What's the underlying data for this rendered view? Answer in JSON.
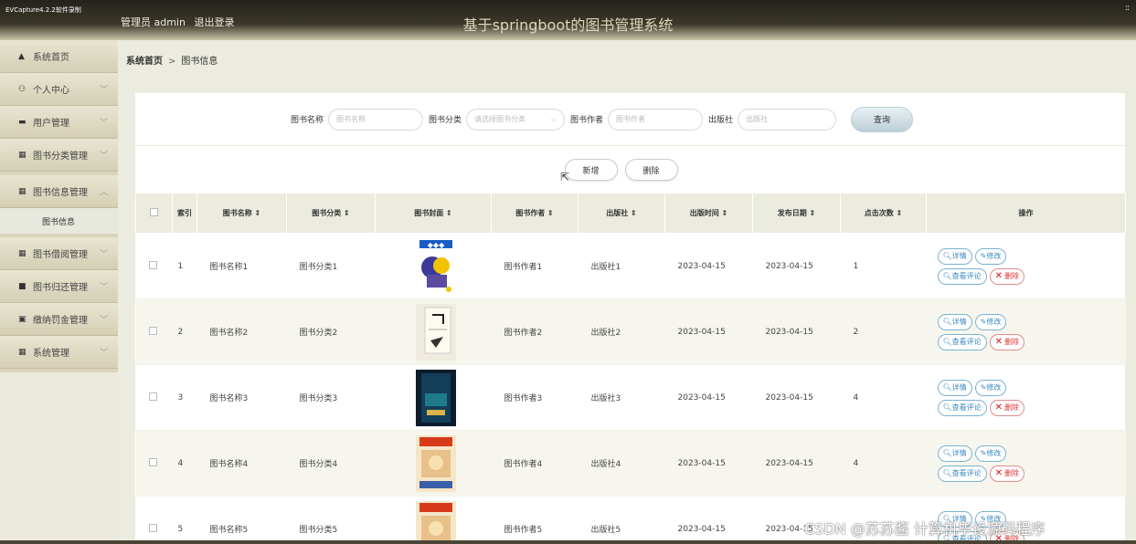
{
  "window": {
    "recorder": "EVCapture4.2.2软件录制",
    "grip": "::"
  },
  "header": {
    "user_label": "管理员 admin",
    "logout": "退出登录",
    "title": "基于springboot的图书管理系统"
  },
  "sidebar": {
    "items": [
      {
        "label": "系统首页",
        "icon": "home-icon",
        "glyph": "▲"
      },
      {
        "label": "个人中心",
        "icon": "user-icon",
        "glyph": "⚇"
      },
      {
        "label": "用户管理",
        "icon": "users-icon",
        "glyph": "▬"
      },
      {
        "label": "图书分类管理",
        "icon": "grid-icon",
        "glyph": "▦"
      },
      {
        "label": "图书信息管理",
        "icon": "grid-icon",
        "glyph": "▦"
      },
      {
        "label": "图书借阅管理",
        "icon": "grid-icon",
        "glyph": "▦"
      },
      {
        "label": "图书归还管理",
        "icon": "doc-icon",
        "glyph": "■"
      },
      {
        "label": "缴纳罚金管理",
        "icon": "money-icon",
        "glyph": "▣"
      },
      {
        "label": "系统管理",
        "icon": "table-icon",
        "glyph": "▦"
      }
    ],
    "subitem": "图书信息"
  },
  "breadcrumb": {
    "home": "系统首页",
    "sep": ">",
    "current": "图书信息"
  },
  "search": {
    "name_label": "图书名称",
    "name_placeholder": "图书名称",
    "cat_label": "图书分类",
    "cat_placeholder": "请选择图书分类",
    "author_label": "图书作者",
    "author_placeholder": "图书作者",
    "pub_label": "出版社",
    "pub_placeholder": "出版社",
    "query": "查询"
  },
  "actions": {
    "add": "新增",
    "delete": "删除"
  },
  "table": {
    "headers": [
      "索引",
      "图书名称 ⇕",
      "图书分类 ⇕",
      "图书封面 ⇕",
      "图书作者 ⇕",
      "出版社 ⇕",
      "出版时间 ⇕",
      "发布日期 ⇕",
      "点击次数 ⇕",
      "操作"
    ],
    "ops": {
      "detail": "详情",
      "edit": "修改",
      "comments": "查看评论",
      "remove": "删除"
    },
    "rows": [
      {
        "idx": "1",
        "name": "图书名称1",
        "cat": "图书分类1",
        "author": "图书作者1",
        "pub": "出版社1",
        "pubtime": "2023-04-15",
        "release": "2023-04-15",
        "clicks": "1"
      },
      {
        "idx": "2",
        "name": "图书名称2",
        "cat": "图书分类2",
        "author": "图书作者2",
        "pub": "出版社2",
        "pubtime": "2023-04-15",
        "release": "2023-04-15",
        "clicks": "2"
      },
      {
        "idx": "3",
        "name": "图书名称3",
        "cat": "图书分类3",
        "author": "图书作者3",
        "pub": "出版社3",
        "pubtime": "2023-04-15",
        "release": "2023-04-15",
        "clicks": "4"
      },
      {
        "idx": "4",
        "name": "图书名称4",
        "cat": "图书分类4",
        "author": "图书作者4",
        "pub": "出版社4",
        "pubtime": "2023-04-15",
        "release": "2023-04-15",
        "clicks": "4"
      },
      {
        "idx": "5",
        "name": "图书名称5",
        "cat": "图书分类5",
        "author": "图书作者5",
        "pub": "出版社5",
        "pubtime": "2023-04-15",
        "release": "2023-04-15",
        "clicks": ""
      }
    ]
  },
  "watermark": "CSDN @苏苏酱  计算机毕设源码程序"
}
